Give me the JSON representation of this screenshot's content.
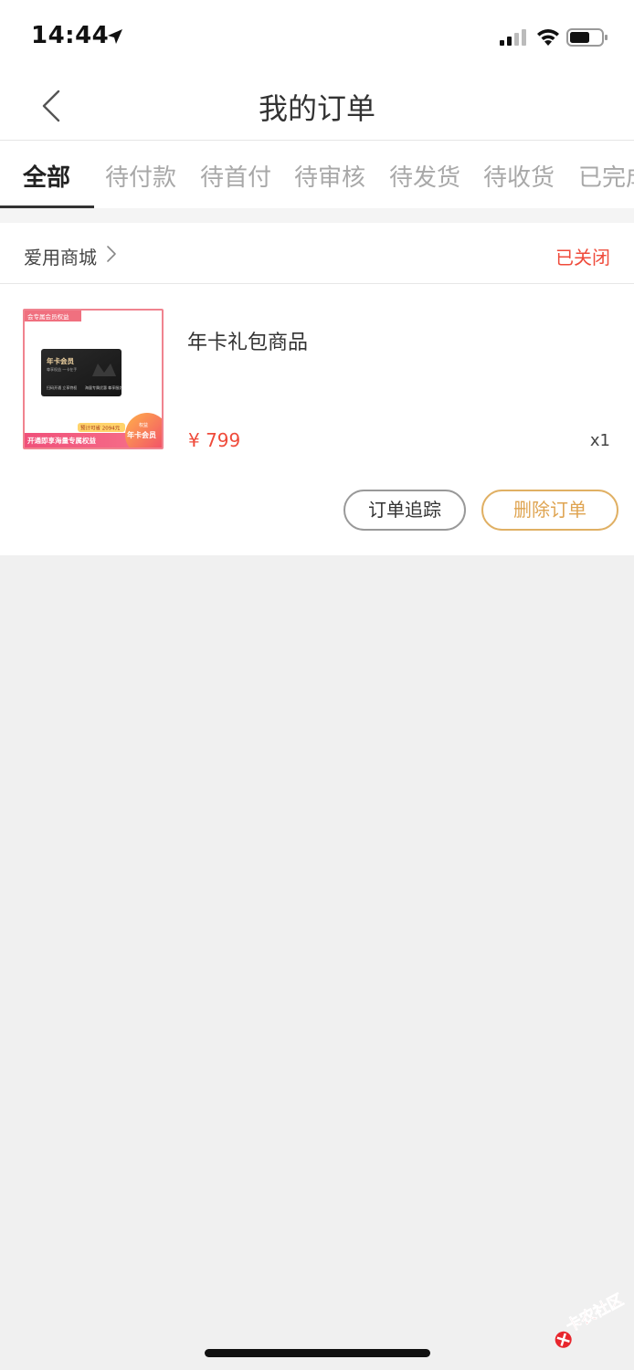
{
  "status_bar": {
    "time": "14:44",
    "icons": [
      "location-arrow-icon",
      "cellular-signal-icon",
      "wifi-icon",
      "battery-icon"
    ]
  },
  "nav": {
    "title": "我的订单",
    "back_icon": "chevron-left-icon"
  },
  "tabs": [
    {
      "label": "全部",
      "active": true
    },
    {
      "label": "待付款",
      "active": false
    },
    {
      "label": "待首付",
      "active": false
    },
    {
      "label": "待审核",
      "active": false
    },
    {
      "label": "待发货",
      "active": false
    },
    {
      "label": "待收货",
      "active": false
    },
    {
      "label": "已完成",
      "active": false
    }
  ],
  "order": {
    "shop_name": "爱用商城",
    "shop_chevron_icon": "chevron-right-icon",
    "status": "已关闭",
    "product": {
      "name": "年卡礼包商品",
      "price": "¥ 799",
      "quantity": "x1",
      "image": {
        "top_badge": "会专属会员权益",
        "card_title": "年卡会员",
        "card_sub": "尊享权益 一卡在手",
        "card_left_note": "扫码开通 立享特权",
        "card_right_note": "海量专属优惠 尊享服务",
        "promo_tag": "预计可省 2094元",
        "bottom_banner": "开通即享海量专属权益",
        "corner_badge_small": "权益",
        "corner_badge": "年卡会员"
      }
    },
    "actions": {
      "track_label": "订单追踪",
      "delete_label": "删除订单"
    }
  },
  "watermark": {
    "text": "卡农社区"
  },
  "colors": {
    "accent_red": "#ef4b3b",
    "accent_gold": "#dfa451",
    "tab_inactive": "#a8a8a8",
    "page_bg": "#f0f0f0"
  }
}
